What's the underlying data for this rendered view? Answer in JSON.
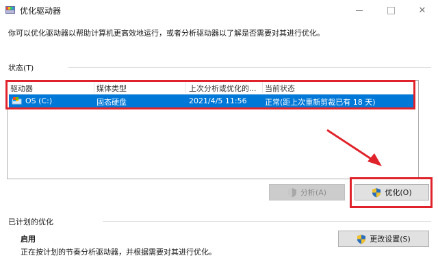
{
  "window": {
    "title": "优化驱动器",
    "app_icon": "defrag-app-icon",
    "controls": [
      "minimize-icon",
      "maximize-icon",
      "close-icon"
    ],
    "close_glyph": "✕"
  },
  "description": "你可以优化驱动器以帮助计算机更高效地运行，或者分析驱动器以了解是否需要对其进行优化。",
  "status": {
    "label": "状态(T)",
    "columns": [
      "驱动器",
      "媒体类型",
      "上次分析或优化的...",
      "当前状态"
    ],
    "rows": [
      {
        "drive": "OS (C:)",
        "media_type": "固态硬盘",
        "last_run": "2021/4/5 11:56",
        "current_status": "正常(距上次重新剪裁已有 18 天)",
        "icon": "drive-icon",
        "selected": true
      }
    ]
  },
  "buttons": {
    "analyze": "分析(A)",
    "optimize": "优化(O)",
    "change_settings": "更改设置(S)"
  },
  "scheduled": {
    "label": "已计划的优化",
    "state": "启用",
    "description": "正在按计划的节奏分析驱动器，并根据需要对其进行优化。"
  },
  "colors": {
    "selection": "#0078d7",
    "annotation_red": "#e0232b",
    "shield_blue": "#2a6ebb",
    "shield_yellow": "#f2c12e"
  }
}
